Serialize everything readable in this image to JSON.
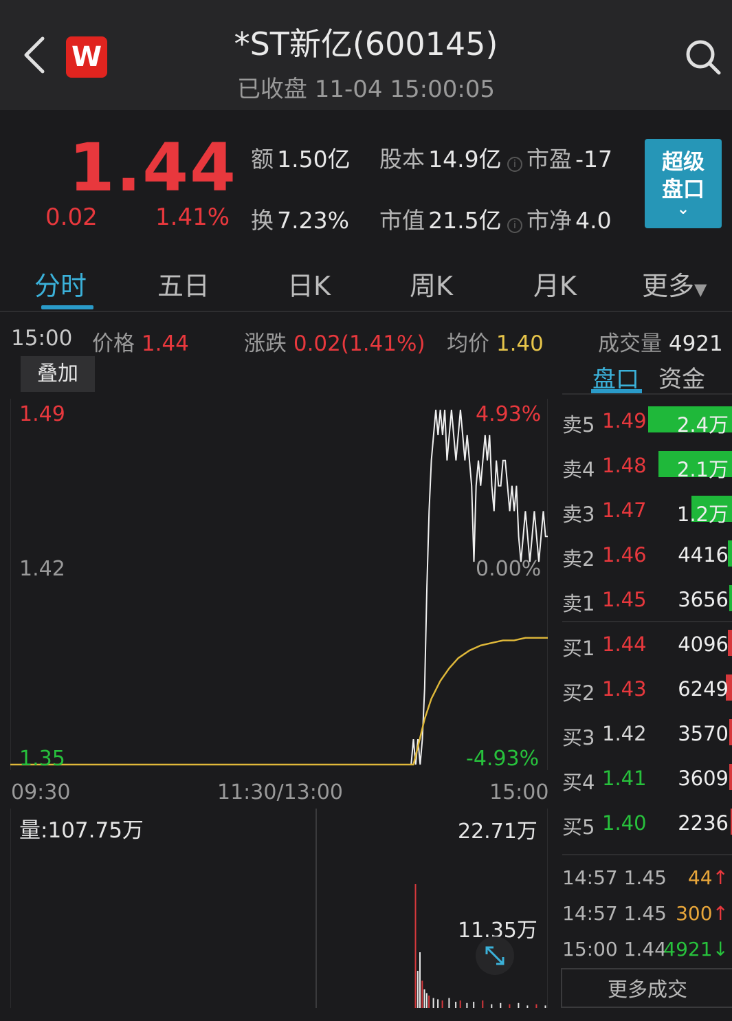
{
  "header": {
    "title": "*ST新亿(600145)",
    "status": "已收盘 11-04 15:00:05",
    "logo_text": "W"
  },
  "quote": {
    "price": "1.44",
    "change": "0.02",
    "change_pct": "1.41%",
    "stats": {
      "amount_label": "额",
      "amount": "1.50亿",
      "capital_label": "股本",
      "capital": "14.9亿",
      "pe_label": "市盈",
      "pe": "-17",
      "turnover_label": "换",
      "turnover": "7.23%",
      "mktcap_label": "市值",
      "mktcap": "21.5亿",
      "pb_label": "市净",
      "pb": "4.0"
    },
    "super_button": {
      "line1": "超级",
      "line2": "盘口"
    }
  },
  "tabs": [
    "分时",
    "五日",
    "日K",
    "周K",
    "月K",
    "更多"
  ],
  "info_row": {
    "time": "15:00",
    "price_label": "价格",
    "price": "1.44",
    "change_label": "涨跌",
    "change": "0.02(1.41%)",
    "avg_label": "均价",
    "avg": "1.40",
    "vol_label": "成交量",
    "vol": "4921"
  },
  "overlay_button": "叠加",
  "order_book": {
    "tabs": [
      "盘口",
      "资金"
    ],
    "asks": [
      {
        "label": "卖5",
        "price": "1.49",
        "volume": "2.4万",
        "bar": 1.0
      },
      {
        "label": "卖4",
        "price": "1.48",
        "volume": "2.1万",
        "bar": 0.88
      },
      {
        "label": "卖3",
        "price": "1.47",
        "volume": "1.2万",
        "bar": 0.5
      },
      {
        "label": "卖2",
        "price": "1.46",
        "volume": "4416",
        "bar": 0.07
      },
      {
        "label": "卖1",
        "price": "1.45",
        "volume": "3656",
        "bar": 0.06
      }
    ],
    "bids": [
      {
        "label": "买1",
        "price": "1.44",
        "volume": "4096",
        "bar": 0.07
      },
      {
        "label": "买2",
        "price": "1.43",
        "volume": "6249",
        "bar": 0.1
      },
      {
        "label": "买3",
        "price": "1.42",
        "volume": "3570",
        "bar": 0.06
      },
      {
        "label": "买4",
        "price": "1.41",
        "volume": "3609",
        "bar": 0.06
      },
      {
        "label": "买5",
        "price": "1.40",
        "volume": "2236",
        "bar": 0.04
      }
    ],
    "trades": [
      {
        "time": "14:57",
        "price": "1.45",
        "volume": "44",
        "dir": "↑"
      },
      {
        "time": "14:57",
        "price": "1.45",
        "volume": "300",
        "dir": "↑"
      },
      {
        "time": "15:00",
        "price": "1.44",
        "volume": "4921",
        "dir": "↓"
      }
    ],
    "more_trades": "更多成交"
  },
  "chart_labels": {
    "price_high": "1.49",
    "price_mid": "1.42",
    "price_low": "1.35",
    "pct_high": "4.93%",
    "pct_mid": "0.00%",
    "pct_low": "-4.93%",
    "t_start": "09:30",
    "t_mid": "11:30/13:00",
    "t_end": "15:00",
    "vol_title": "量:107.75万",
    "vol_max": "22.71万",
    "vol_mid": "11.35万"
  },
  "chart_data": {
    "type": "line",
    "x_range": [
      0,
      240
    ],
    "ylim": [
      1.35,
      1.49
    ],
    "series": [
      {
        "x": [
          0,
          179,
          180,
          181,
          182,
          183,
          184,
          185,
          186,
          187,
          188,
          189,
          190,
          191,
          192,
          193,
          194,
          195,
          196,
          197,
          198,
          199,
          200,
          201,
          202,
          203,
          204,
          205,
          206,
          207,
          208,
          209,
          210,
          211,
          212,
          213,
          214,
          215,
          216,
          217,
          218,
          219,
          220,
          221,
          222,
          223,
          224,
          225,
          226,
          227,
          228,
          229,
          230,
          231,
          232,
          233,
          234,
          235,
          236,
          237,
          238,
          239,
          240
        ],
        "y": [
          1.35,
          1.35,
          1.36,
          1.35,
          1.36,
          1.35,
          1.36,
          1.38,
          1.42,
          1.45,
          1.47,
          1.48,
          1.49,
          1.48,
          1.49,
          1.48,
          1.49,
          1.47,
          1.48,
          1.49,
          1.48,
          1.47,
          1.48,
          1.49,
          1.48,
          1.47,
          1.48,
          1.47,
          1.46,
          1.43,
          1.46,
          1.47,
          1.46,
          1.47,
          1.48,
          1.47,
          1.48,
          1.46,
          1.45,
          1.47,
          1.46,
          1.46,
          1.47,
          1.47,
          1.46,
          1.45,
          1.46,
          1.45,
          1.46,
          1.44,
          1.43,
          1.44,
          1.45,
          1.44,
          1.43,
          1.44,
          1.45,
          1.44,
          1.43,
          1.44,
          1.45,
          1.44,
          1.44
        ]
      },
      {
        "x": [
          0,
          180,
          182,
          185,
          188,
          192,
          196,
          200,
          205,
          210,
          215,
          220,
          225,
          230,
          235,
          240
        ],
        "y": [
          1.35,
          1.35,
          1.357,
          1.368,
          1.376,
          1.383,
          1.388,
          1.392,
          1.395,
          1.397,
          1.398,
          1.399,
          1.399,
          1.4,
          1.4,
          1.4
        ]
      }
    ],
    "volume": {
      "max_label": "22.71万",
      "x": [
        180,
        181,
        182,
        183,
        184,
        185,
        186,
        188,
        190,
        192,
        195,
        198,
        200,
        203,
        206,
        210,
        214,
        218,
        222,
        226,
        230,
        234,
        238,
        240
      ],
      "y": [
        1.0,
        0.3,
        0.45,
        0.22,
        0.15,
        0.12,
        0.1,
        0.08,
        0.07,
        0.06,
        0.08,
        0.05,
        0.06,
        0.04,
        0.05,
        0.06,
        0.03,
        0.04,
        0.03,
        0.04,
        0.02,
        0.03,
        0.02,
        0.02
      ]
    }
  }
}
